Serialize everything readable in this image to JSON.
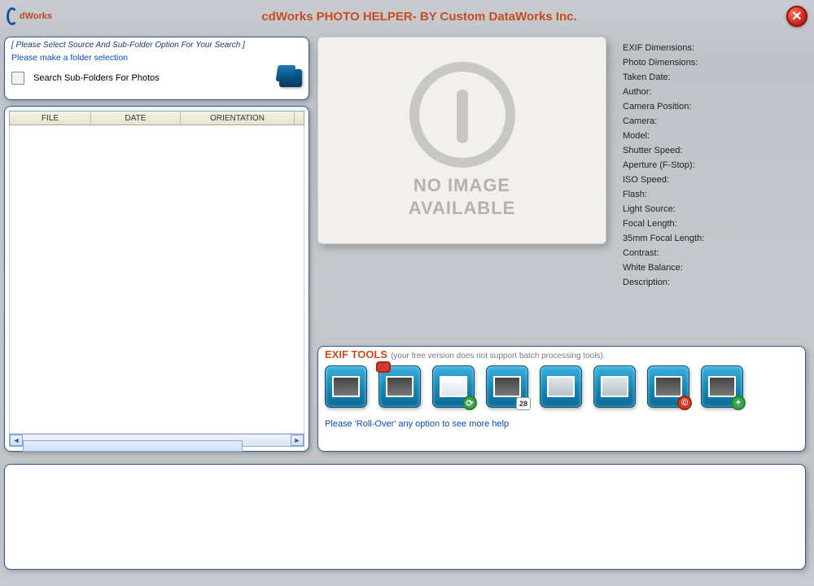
{
  "app": {
    "logo_text": "dWorks",
    "title": "cdWorks PHOTO HELPER- BY Custom DataWorks Inc."
  },
  "search": {
    "hint_bracket": "[ Please Select Source And Sub-Folder Option For Your Search ]",
    "hint_select": "Please make a folder selection",
    "checkbox_label": "Search Sub-Folders For Photos"
  },
  "file_list": {
    "columns": {
      "file": "FILE",
      "date": "DATE",
      "orientation": "ORIENTATION"
    },
    "rows": []
  },
  "preview": {
    "no_image_line1": "NO IMAGE",
    "no_image_line2": "AVAILABLE"
  },
  "exif": {
    "labels": [
      "EXIF Dimensions:",
      "Photo Dimensions:",
      "Taken Date:",
      "Author:",
      "Camera Position:",
      "Camera:",
      "Model:",
      "Shutter Speed:",
      "Aperture (F-Stop):",
      "ISO Speed:",
      "Flash:",
      "Light Source:",
      "Focal Length:",
      "35mm Focal Length:",
      "Contrast:",
      "White Balance:",
      "Description:"
    ]
  },
  "tools": {
    "title": "EXIF TOOLS",
    "note": "(your free version does not support batch processing tools).",
    "help": "Please 'Roll-Over' any option to see more help",
    "buttons": [
      {
        "name": "rotate-tool"
      },
      {
        "name": "export-tool"
      },
      {
        "name": "exif-refresh-tool"
      },
      {
        "name": "date-tool",
        "badge_text": "28"
      },
      {
        "name": "caption-tool"
      },
      {
        "name": "edit-tool"
      },
      {
        "name": "copyright-tool"
      },
      {
        "name": "add-tool",
        "badge_text": "+"
      }
    ]
  }
}
